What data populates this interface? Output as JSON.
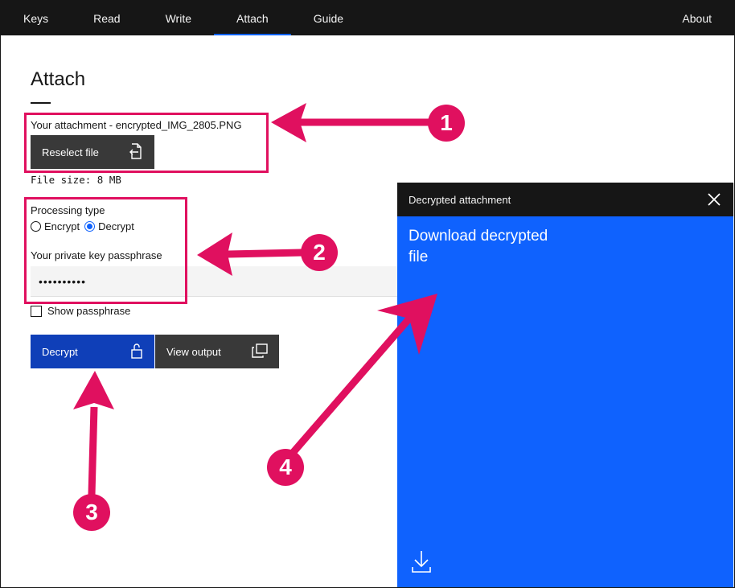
{
  "nav": {
    "items": [
      {
        "label": "Keys"
      },
      {
        "label": "Read"
      },
      {
        "label": "Write"
      },
      {
        "label": "Attach",
        "active": true
      },
      {
        "label": "Guide"
      }
    ],
    "about_label": "About"
  },
  "main": {
    "title": "Attach",
    "attachment_label": "Your attachment - encrypted_IMG_2805.PNG",
    "reselect_label": "Reselect file",
    "file_size": "File size: 8 MB",
    "processing_label": "Processing type",
    "radio_encrypt": "Encrypt",
    "radio_decrypt": "Decrypt",
    "selected_processing": "Decrypt",
    "passphrase_label": "Your private key passphrase",
    "passphrase_value": "••••••••••",
    "show_passphrase_label": "Show passphrase",
    "show_passphrase_checked": false,
    "decrypt_label": "Decrypt",
    "view_output_label": "View output"
  },
  "panel": {
    "title": "Decrypted attachment",
    "download_label": "Download decrypted file"
  },
  "annotations": {
    "badges": [
      "1",
      "2",
      "3",
      "4"
    ]
  },
  "colors": {
    "nav_bg": "#161616",
    "accent_blue": "#0f62fe",
    "primary_button": "#0f3fb8",
    "secondary_button": "#393939",
    "annotation_pink": "#e0105f"
  },
  "icons": {
    "reselect": "file-import-icon",
    "decrypt": "unlock-icon",
    "view_output": "launch-icon",
    "close": "close-icon",
    "download": "download-icon"
  }
}
